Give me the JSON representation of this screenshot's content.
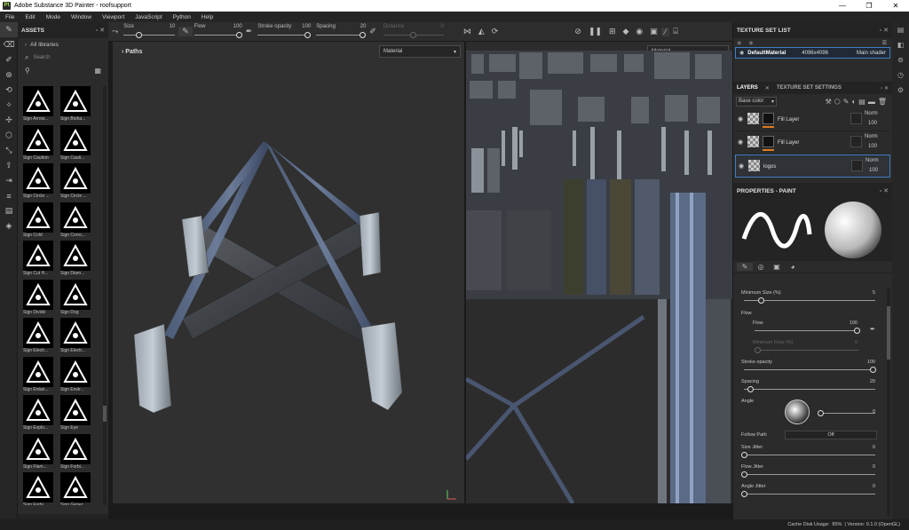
{
  "window": {
    "title": "Adobe Substance 3D Painter - roofsupport",
    "app_icon": "Pt",
    "controls": [
      "—",
      "❐",
      "✕"
    ]
  },
  "menu": [
    "File",
    "Edit",
    "Mode",
    "Window",
    "Viewport",
    "JavaScript",
    "Python",
    "Help"
  ],
  "toolbar": {
    "size": {
      "label": "Size",
      "value": "10",
      "fraction": 0.1
    },
    "flow": {
      "label": "Flow",
      "value": "100",
      "fraction": 1.0
    },
    "stroke_opacity": {
      "label": "Stroke opacity",
      "value": "100",
      "fraction": 1.0
    },
    "spacing": {
      "label": "Spacing",
      "value": "20",
      "fraction": 0.2
    },
    "distance": {
      "label": "Distance",
      "value": "0",
      "fraction": 0.5
    }
  },
  "assets": {
    "title": "ASSETS",
    "library": "All libraries",
    "search_placeholder": "Search",
    "items": [
      {
        "label": "Sign Arrow...",
        "icon": "arrow-sign-icon"
      },
      {
        "label": "Sign Bioha...",
        "icon": "biohazard-sign-icon"
      },
      {
        "label": "Sign Caution",
        "icon": "caution-tape-icon"
      },
      {
        "label": "Sign Cauti...",
        "icon": "caution-sign-icon"
      },
      {
        "label": "Sign Circle ...",
        "icon": "info-circle-icon"
      },
      {
        "label": "Sign Circle ...",
        "icon": "number-one-circle-icon"
      },
      {
        "label": "Sign Cold",
        "icon": "snowflake-sign-icon"
      },
      {
        "label": "Sign Corro...",
        "icon": "corrosive-sign-icon"
      },
      {
        "label": "Sign Cut H...",
        "icon": "cut-hand-sign-icon"
      },
      {
        "label": "Sign Diam...",
        "icon": "diamond-sign-icon"
      },
      {
        "label": "Sign Divide",
        "icon": "divide-sign-icon"
      },
      {
        "label": "Sign Dog",
        "icon": "dog-sign-icon"
      },
      {
        "label": "Sign Electr...",
        "icon": "electric-sign-icon"
      },
      {
        "label": "Sign Electr...",
        "icon": "electric-warning-icon"
      },
      {
        "label": "Sign Entan...",
        "icon": "entanglement-sign-icon"
      },
      {
        "label": "Sign Envir...",
        "icon": "environment-sign-icon"
      },
      {
        "label": "Sign Explo...",
        "icon": "explosive-sign-icon"
      },
      {
        "label": "Sign Eye",
        "icon": "eye-sign-icon"
      },
      {
        "label": "Sign Flam...",
        "icon": "flammable-sign-icon"
      },
      {
        "label": "Sign Forbi...",
        "icon": "forbidden-sign-icon"
      },
      {
        "label": "Sign Forbi...",
        "icon": "no-entry-sign-icon"
      },
      {
        "label": "Sign Gener...",
        "icon": "general-warning-icon"
      },
      {
        "label": "Sign ...",
        "icon": "warning-sign-icon"
      },
      {
        "label": "Sign ...",
        "icon": "x-sign-icon"
      }
    ]
  },
  "viewport3d": {
    "paths_label": "Paths",
    "mode": "Material"
  },
  "viewport2d": {
    "mode": "Material"
  },
  "texture_set_list": {
    "title": "TEXTURE SET LIST",
    "name": "DefaultMaterial",
    "resolution": "4096x4096",
    "shader": "Main shader"
  },
  "layers": {
    "tab_layers": "LAYERS",
    "tab_tss": "TEXTURE SET SETTINGS",
    "channel": "Base color",
    "items": [
      {
        "name": "Fill Layer",
        "blend": "Norm",
        "opacity": "100",
        "selected": false
      },
      {
        "name": "Fill Layer",
        "blend": "Norm",
        "opacity": "100",
        "selected": false
      },
      {
        "name": "logos",
        "blend": "Norm",
        "opacity": "100",
        "selected": true
      }
    ]
  },
  "properties": {
    "title": "PROPERTIES - PAINT",
    "min_size": {
      "label": "Minimum Size (%)",
      "value": "5",
      "fraction": 0.05
    },
    "flow_section": "Flow",
    "flow": {
      "label": "Flow",
      "value": "100",
      "fraction": 1.0
    },
    "min_flow": {
      "label": "Minimum Flow (%)",
      "value": "0",
      "fraction": 0.0
    },
    "stroke_opacity": {
      "label": "Stroke opacity",
      "value": "100",
      "fraction": 1.0
    },
    "spacing": {
      "label": "Spacing",
      "value": "20",
      "fraction": 0.02
    },
    "angle": {
      "label": "Angle",
      "value": "0",
      "fraction": 0.0
    },
    "follow_path": {
      "label": "Follow Path",
      "value": "Off"
    },
    "size_jitter": {
      "label": "Size Jitter",
      "value": "0",
      "fraction": 0.0
    },
    "flow_jitter": {
      "label": "Flow Jitter",
      "value": "0",
      "fraction": 0.0
    },
    "angle_jitter": {
      "label": "Angle Jitter",
      "value": "0",
      "fraction": 0.0
    }
  },
  "status": {
    "cache": "Cache Disk Usage:",
    "cache_value": "85%",
    "version": "| Version: 9.1.0 (OpenGL)"
  },
  "colors": {
    "accent": "#3d7fc0",
    "layer_bar": "#e07a1f",
    "beam": "#5b6b86"
  }
}
